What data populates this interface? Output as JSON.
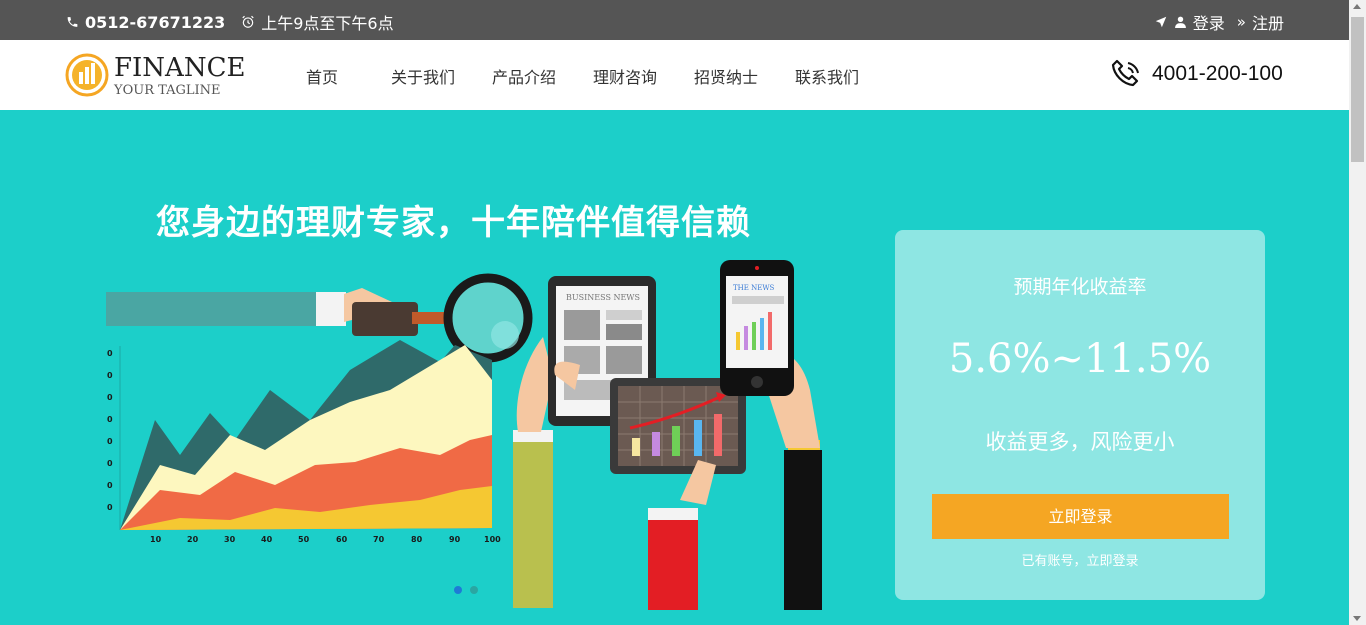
{
  "topbar": {
    "phone": "0512-67671223",
    "hours": "上午9点至下午6点",
    "login": "登录",
    "register": "注册"
  },
  "logo": {
    "name": "FINANCE",
    "tagline": "YOUR TAGLINE"
  },
  "nav": {
    "items": [
      "首页",
      "关于我们",
      "产品介绍",
      "理财咨询",
      "招贤纳士",
      "联系我们"
    ]
  },
  "hotline": {
    "number": "4001-200-100"
  },
  "hero": {
    "slogan": "您身边的理财专家，十年陪伴值得信赖",
    "chart_ticks_x": [
      "10",
      "20",
      "30",
      "40",
      "50",
      "60",
      "70",
      "80",
      "90",
      "100"
    ],
    "chart_ticks_y": [
      "0",
      "0",
      "0",
      "0",
      "0",
      "0",
      "0",
      "0"
    ],
    "tablet_caption": "BUSINESS NEWS",
    "phone_caption": "THE NEWS"
  },
  "card": {
    "label": "预期年化收益率",
    "rate": "5.6%~11.5%",
    "desc": "收益更多，风险更小",
    "button": "立即登录",
    "hint": "已有账号，立即登录"
  },
  "colors": {
    "topbar": "#555555",
    "hero": "#1ccfc9",
    "card": "#8ee6e3",
    "button": "#f5a623"
  }
}
